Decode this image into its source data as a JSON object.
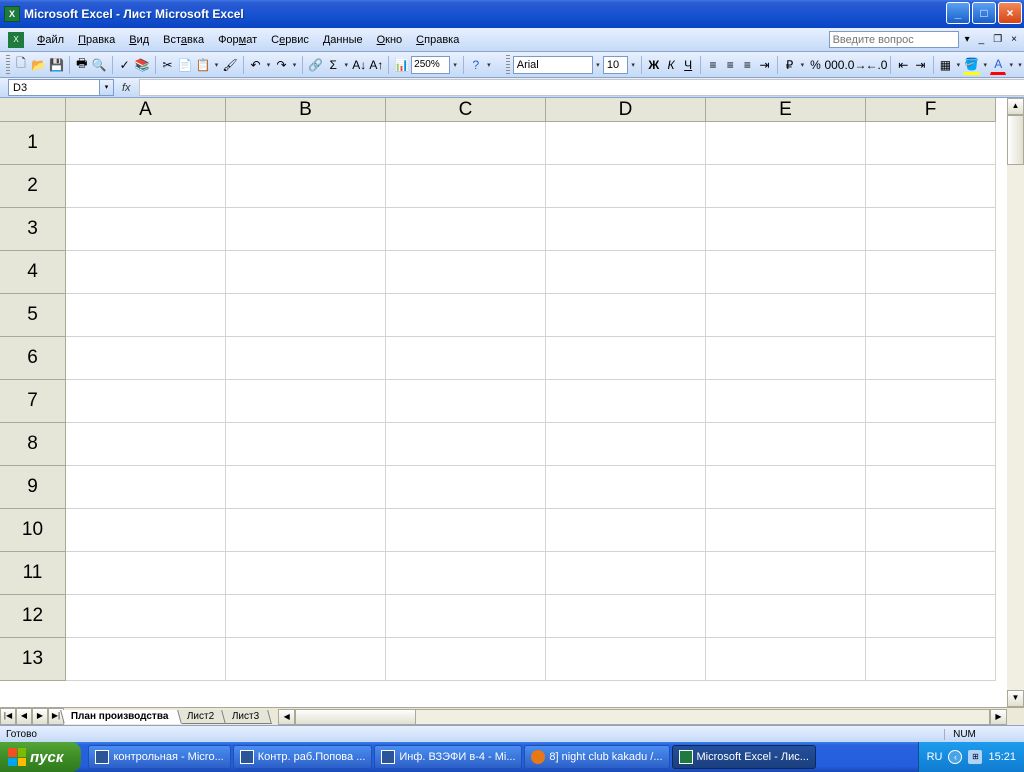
{
  "titlebar": {
    "app": "Microsoft Excel",
    "doc": "Лист Microsoft Excel"
  },
  "menus": [
    "Файл",
    "Правка",
    "Вид",
    "Вставка",
    "Формат",
    "Сервис",
    "Данные",
    "Окно",
    "Справка"
  ],
  "ask_placeholder": "Введите вопрос",
  "toolbar": {
    "zoom": "250%",
    "font_name": "Arial",
    "font_size": "10",
    "bold": "Ж",
    "italic": "К",
    "underline": "Ч"
  },
  "namebox": "D3",
  "fx_label": "fx",
  "columns": [
    "A",
    "B",
    "C",
    "D",
    "E",
    "F"
  ],
  "rows": [
    "1",
    "2",
    "3",
    "4",
    "5",
    "6",
    "7",
    "8",
    "9",
    "10",
    "11",
    "12",
    "13"
  ],
  "sheets": [
    "План производства",
    "Лист2",
    "Лист3"
  ],
  "status": {
    "ready": "Готово",
    "num": "NUM"
  },
  "taskbar": {
    "start": "пуск",
    "items": [
      {
        "icon": "word",
        "label": "контрольная - Micro..."
      },
      {
        "icon": "word",
        "label": "Контр. раб.Попова ..."
      },
      {
        "icon": "word",
        "label": "Инф. ВЗЭФИ в-4 - Mi..."
      },
      {
        "icon": "ff",
        "label": "8] night club kakadu /..."
      },
      {
        "icon": "excel",
        "label": "Microsoft Excel - Лис...",
        "active": true
      }
    ],
    "lang": "RU",
    "clock": "15:21"
  }
}
